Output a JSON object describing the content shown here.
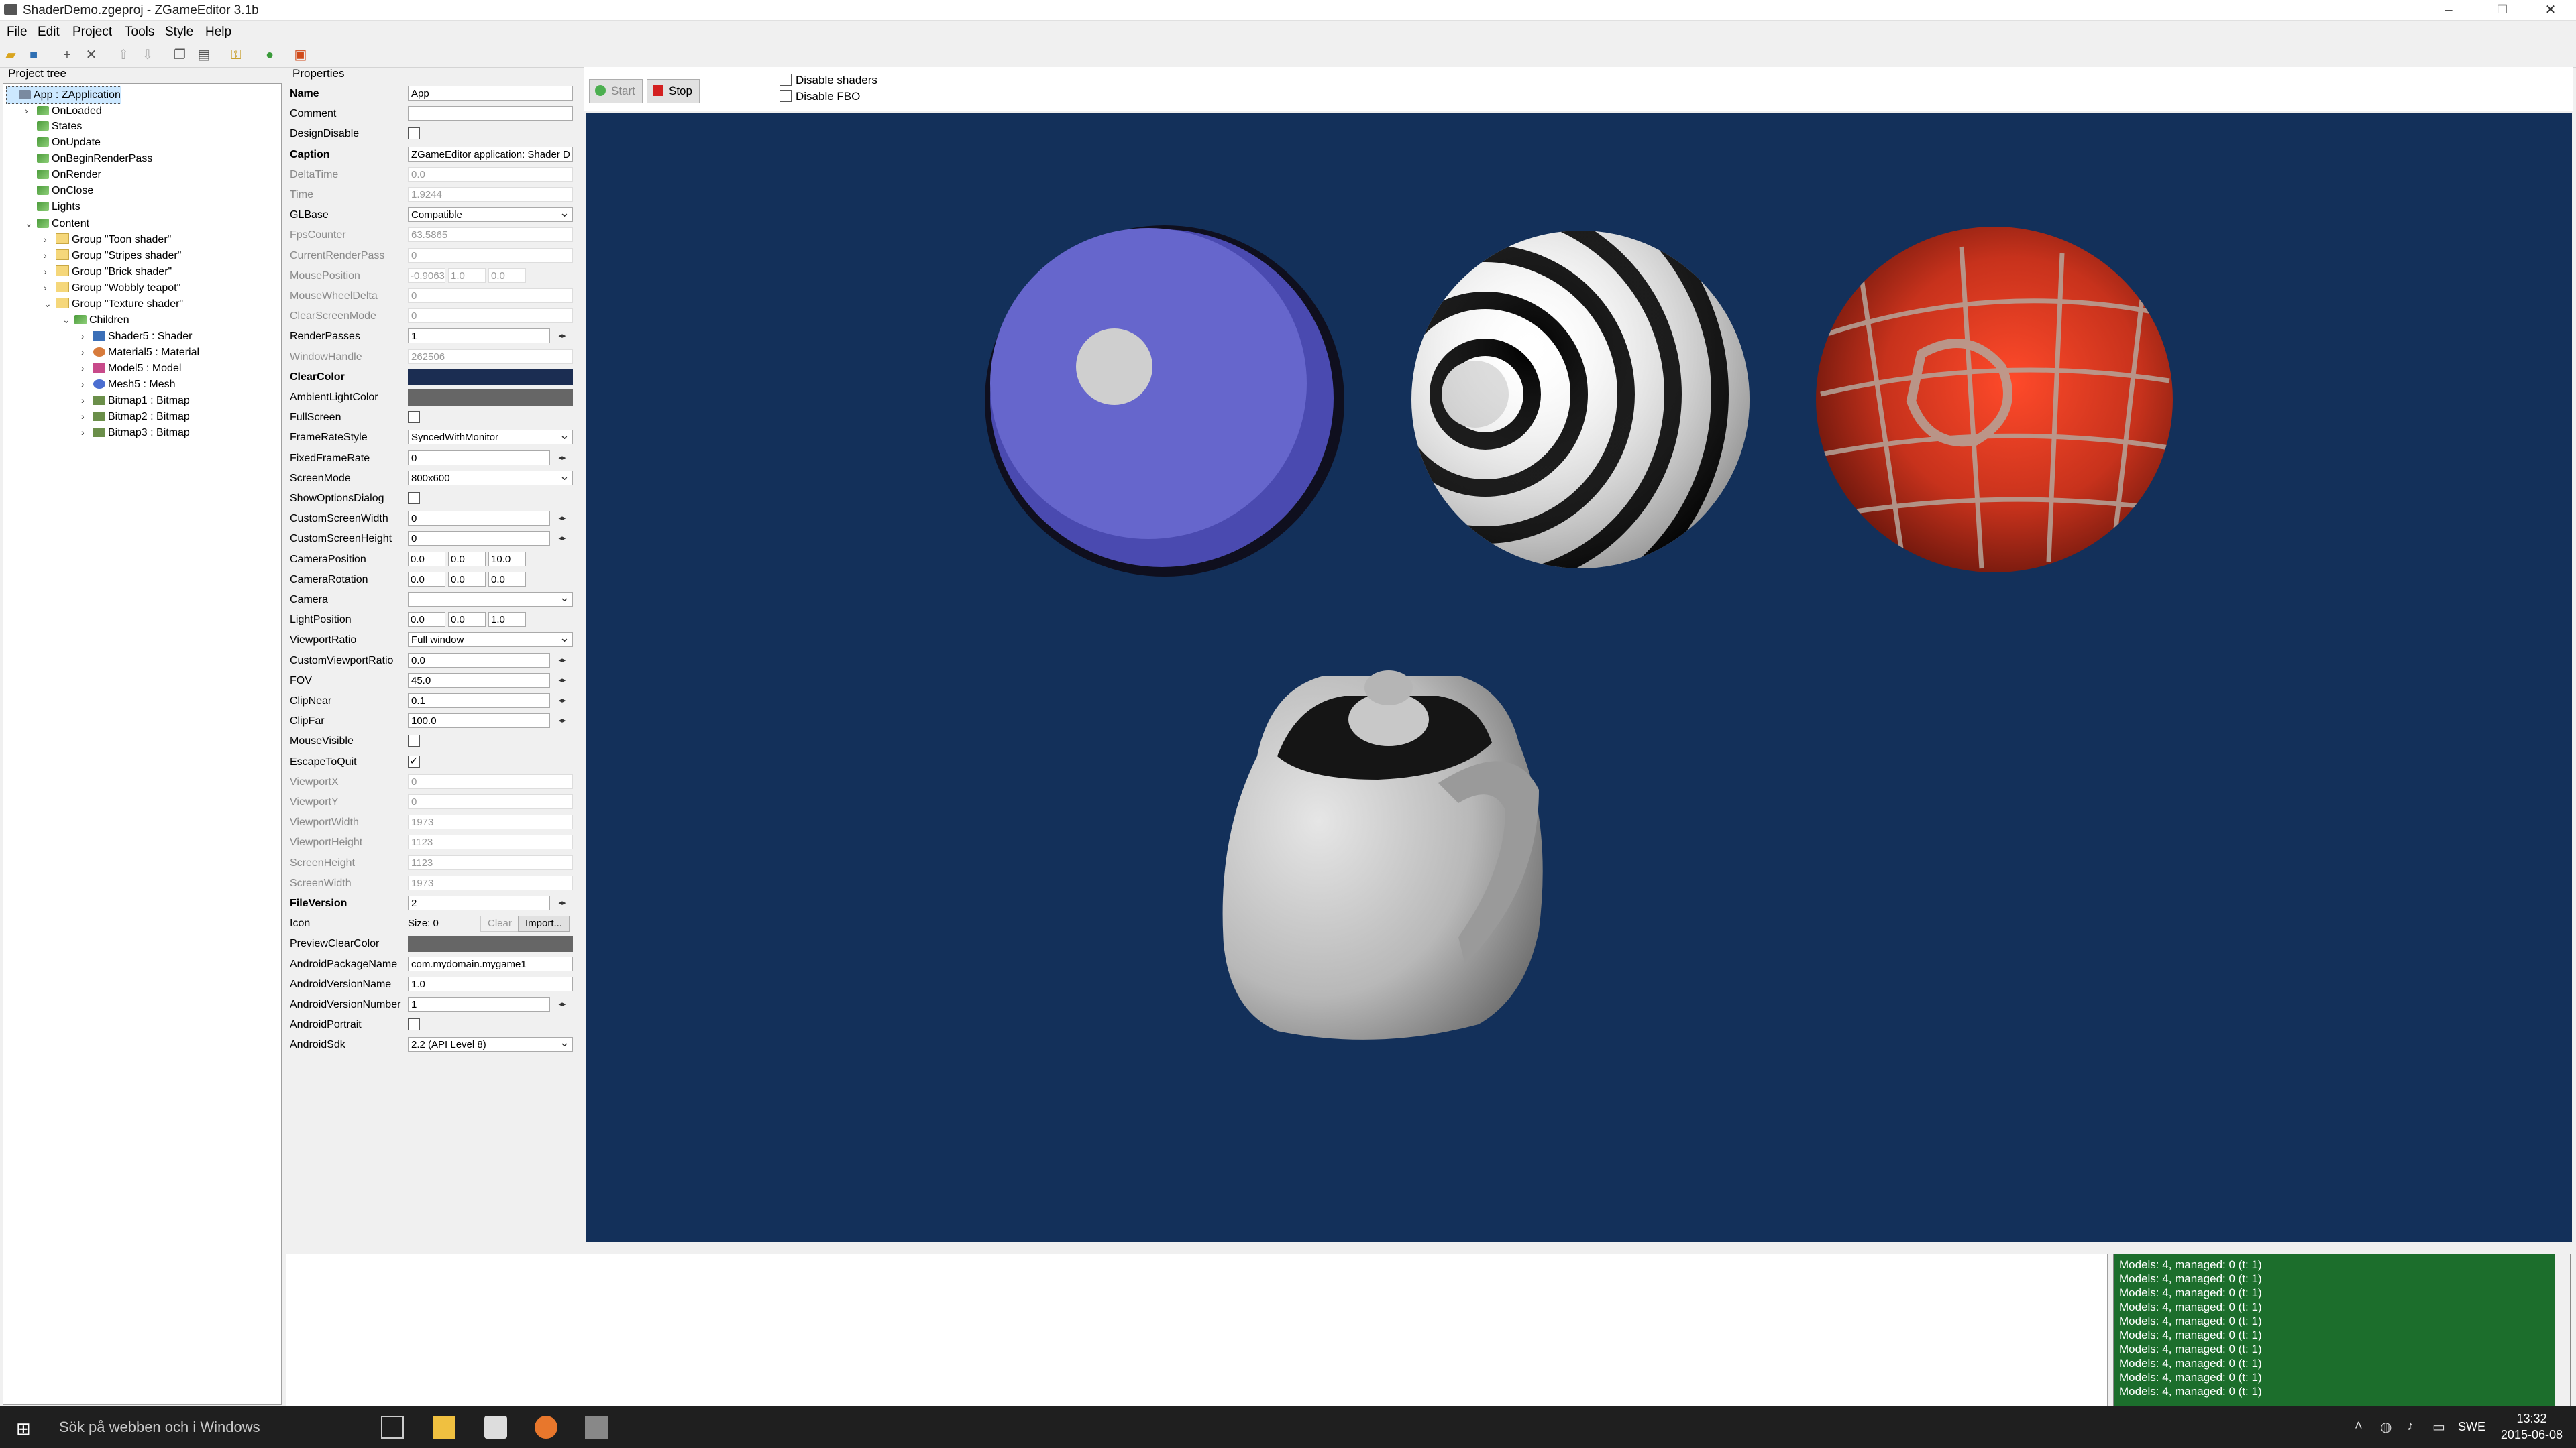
{
  "window": {
    "title": "ShaderDemo.zgeproj - ZGameEditor 3.1b",
    "minimize": "–",
    "maximize": "❐",
    "close": "✕"
  },
  "menu": [
    "File",
    "Edit",
    "Project",
    "Tools",
    "Style",
    "Help"
  ],
  "panels": {
    "tree_title": "Project tree",
    "props_title": "Properties"
  },
  "tree": [
    {
      "label": "App : ZApplication",
      "indent": 0,
      "exp": "",
      "icon": "ico-app",
      "sel": true
    },
    {
      "label": "OnLoaded",
      "indent": 1,
      "exp": "›",
      "icon": "ico-event"
    },
    {
      "label": "States",
      "indent": 1,
      "exp": "",
      "icon": "ico-event"
    },
    {
      "label": "OnUpdate",
      "indent": 1,
      "exp": "",
      "icon": "ico-event"
    },
    {
      "label": "OnBeginRenderPass",
      "indent": 1,
      "exp": "",
      "icon": "ico-event"
    },
    {
      "label": "OnRender",
      "indent": 1,
      "exp": "",
      "icon": "ico-event"
    },
    {
      "label": "OnClose",
      "indent": 1,
      "exp": "",
      "icon": "ico-event"
    },
    {
      "label": "Lights",
      "indent": 1,
      "exp": "",
      "icon": "ico-event"
    },
    {
      "label": "Content",
      "indent": 1,
      "exp": "⌄",
      "icon": "ico-event"
    },
    {
      "label": "Group \"Toon shader\"",
      "indent": 2,
      "exp": "›",
      "icon": "ico-folder"
    },
    {
      "label": "Group \"Stripes shader\"",
      "indent": 2,
      "exp": "›",
      "icon": "ico-folder"
    },
    {
      "label": "Group \"Brick shader\"",
      "indent": 2,
      "exp": "›",
      "icon": "ico-folder"
    },
    {
      "label": "Group \"Wobbly teapot\"",
      "indent": 2,
      "exp": "›",
      "icon": "ico-folder"
    },
    {
      "label": "Group \"Texture shader\"",
      "indent": 2,
      "exp": "⌄",
      "icon": "ico-folder"
    },
    {
      "label": "Children",
      "indent": 3,
      "exp": "⌄",
      "icon": "ico-event"
    },
    {
      "label": "Shader5 : Shader",
      "indent": 4,
      "exp": "›",
      "icon": "ico-shader"
    },
    {
      "label": "Material5 : Material",
      "indent": 4,
      "exp": "›",
      "icon": "ico-mat"
    },
    {
      "label": "Model5 : Model",
      "indent": 4,
      "exp": "›",
      "icon": "ico-model"
    },
    {
      "label": "Mesh5 : Mesh",
      "indent": 4,
      "exp": "›",
      "icon": "ico-mesh"
    },
    {
      "label": "Bitmap1 : Bitmap",
      "indent": 4,
      "exp": "›",
      "icon": "ico-bmp"
    },
    {
      "label": "Bitmap2 : Bitmap",
      "indent": 4,
      "exp": "›",
      "icon": "ico-bmp"
    },
    {
      "label": "Bitmap3 : Bitmap",
      "indent": 4,
      "exp": "›",
      "icon": "ico-bmp"
    }
  ],
  "props": [
    {
      "label": "Name",
      "type": "text",
      "value": "App",
      "bold": true
    },
    {
      "label": "Comment",
      "type": "text",
      "value": ""
    },
    {
      "label": "DesignDisable",
      "type": "check",
      "value": ""
    },
    {
      "label": "Caption",
      "type": "text",
      "value": "ZGameEditor application: Shader D",
      "bold": true
    },
    {
      "label": "DeltaTime",
      "type": "text",
      "value": "0.0",
      "dis": true
    },
    {
      "label": "Time",
      "type": "text",
      "value": "1.9244",
      "dis": true
    },
    {
      "label": "GLBase",
      "type": "drop",
      "value": "Compatible"
    },
    {
      "label": "FpsCounter",
      "type": "text",
      "value": "63.5865",
      "dis": true
    },
    {
      "label": "CurrentRenderPass",
      "type": "text",
      "value": "0",
      "dis": true
    },
    {
      "label": "MousePosition",
      "type": "vec",
      "value": [
        "-0.9063",
        "1.0",
        "0.0"
      ],
      "dis": true
    },
    {
      "label": "MouseWheelDelta",
      "type": "text",
      "value": "0",
      "dis": true
    },
    {
      "label": "ClearScreenMode",
      "type": "text",
      "value": "0",
      "dis": true
    },
    {
      "label": "RenderPasses",
      "type": "spin",
      "value": "1"
    },
    {
      "label": "WindowHandle",
      "type": "text",
      "value": "262506",
      "dis": true
    },
    {
      "label": "ClearColor",
      "type": "color",
      "value": "#1b2d52",
      "bold": true
    },
    {
      "label": "AmbientLightColor",
      "type": "color",
      "value": "#666666"
    },
    {
      "label": "FullScreen",
      "type": "check",
      "value": ""
    },
    {
      "label": "FrameRateStyle",
      "type": "drop",
      "value": "SyncedWithMonitor"
    },
    {
      "label": "FixedFrameRate",
      "type": "spin",
      "value": "0"
    },
    {
      "label": "ScreenMode",
      "type": "drop",
      "value": "800x600"
    },
    {
      "label": "ShowOptionsDialog",
      "type": "check",
      "value": ""
    },
    {
      "label": "CustomScreenWidth",
      "type": "spin",
      "value": "0"
    },
    {
      "label": "CustomScreenHeight",
      "type": "spin",
      "value": "0"
    },
    {
      "label": "CameraPosition",
      "type": "vec",
      "value": [
        "0.0",
        "0.0",
        "10.0"
      ]
    },
    {
      "label": "CameraRotation",
      "type": "vec",
      "value": [
        "0.0",
        "0.0",
        "0.0"
      ]
    },
    {
      "label": "Camera",
      "type": "drop",
      "value": ""
    },
    {
      "label": "LightPosition",
      "type": "vec",
      "value": [
        "0.0",
        "0.0",
        "1.0"
      ]
    },
    {
      "label": "ViewportRatio",
      "type": "drop",
      "value": "Full window"
    },
    {
      "label": "CustomViewportRatio",
      "type": "spin",
      "value": "0.0"
    },
    {
      "label": "FOV",
      "type": "spin",
      "value": "45.0"
    },
    {
      "label": "ClipNear",
      "type": "spin",
      "value": "0.1"
    },
    {
      "label": "ClipFar",
      "type": "spin",
      "value": "100.0"
    },
    {
      "label": "MouseVisible",
      "type": "check",
      "value": ""
    },
    {
      "label": "EscapeToQuit",
      "type": "check",
      "value": "✓"
    },
    {
      "label": "ViewportX",
      "type": "text",
      "value": "0",
      "dis": true
    },
    {
      "label": "ViewportY",
      "type": "text",
      "value": "0",
      "dis": true
    },
    {
      "label": "ViewportWidth",
      "type": "text",
      "value": "1973",
      "dis": true
    },
    {
      "label": "ViewportHeight",
      "type": "text",
      "value": "1123",
      "dis": true
    },
    {
      "label": "ScreenHeight",
      "type": "text",
      "value": "1123",
      "dis": true
    },
    {
      "label": "ScreenWidth",
      "type": "text",
      "value": "1973",
      "dis": true
    },
    {
      "label": "FileVersion",
      "type": "spin",
      "value": "2",
      "bold": true
    },
    {
      "label": "Icon",
      "type": "icon",
      "value": "Size: 0",
      "clear": "Clear",
      "import": "Import..."
    },
    {
      "label": "PreviewClearColor",
      "type": "color",
      "value": "#666666"
    },
    {
      "label": "AndroidPackageName",
      "type": "text",
      "value": "com.mydomain.mygame1"
    },
    {
      "label": "AndroidVersionName",
      "type": "text",
      "value": "1.0"
    },
    {
      "label": "AndroidVersionNumber",
      "type": "spin",
      "value": "1"
    },
    {
      "label": "AndroidPortrait",
      "type": "check",
      "value": ""
    },
    {
      "label": "AndroidSdk",
      "type": "drop",
      "value": "2.2 (API Level 8)"
    }
  ],
  "viewport": {
    "start": "Start",
    "stop": "Stop",
    "disable_shaders": "Disable shaders",
    "disable_fbo": "Disable FBO"
  },
  "log": [
    "Models: 4, managed: 0 (t: 1)",
    "Models: 4, managed: 0 (t: 1)",
    "Models: 4, managed: 0 (t: 1)",
    "Models: 4, managed: 0 (t: 1)",
    "Models: 4, managed: 0 (t: 1)",
    "Models: 4, managed: 0 (t: 1)",
    "Models: 4, managed: 0 (t: 1)",
    "Models: 4, managed: 0 (t: 1)",
    "Models: 4, managed: 0 (t: 1)",
    "Models: 4, managed: 0 (t: 1)"
  ],
  "taskbar": {
    "search": "Sök på webben och i Windows",
    "lang": "SWE",
    "time": "13:32",
    "date": "2015-06-08"
  }
}
